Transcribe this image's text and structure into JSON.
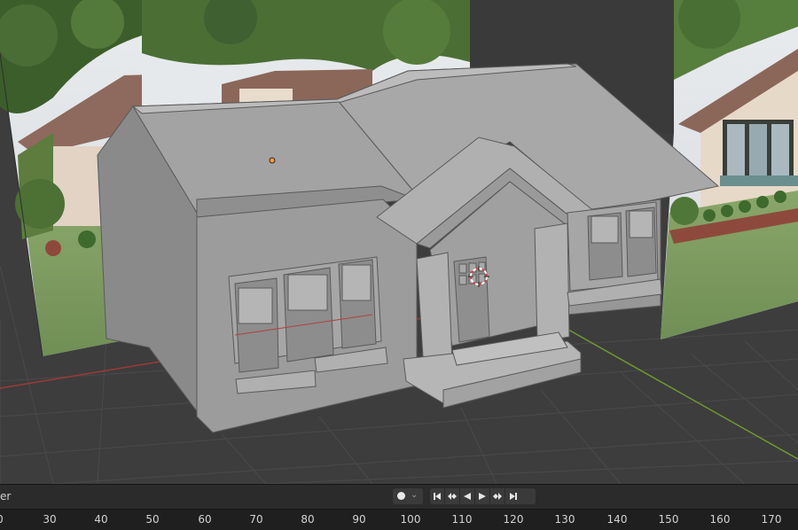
{
  "viewport": {
    "reference_image": "house-photo-reference",
    "model": "house-3d-model",
    "cursor_icon": "3d-cursor-icon",
    "origin_icon": "object-origin-icon"
  },
  "timeline_header": {
    "label_fragment": "er",
    "record_icon": "record-icon",
    "record_dropdown_icon": "chevron-down-icon",
    "transport_icons": [
      "jump-to-start-icon",
      "previous-keyframe-icon",
      "play-reverse-icon",
      "play-icon",
      "next-keyframe-icon",
      "jump-to-end-icon"
    ]
  },
  "timeline_ruler": {
    "ticks": [
      "0",
      "30",
      "40",
      "50",
      "60",
      "70",
      "80",
      "90",
      "100",
      "110",
      "120",
      "130",
      "140",
      "150",
      "160",
      "170"
    ]
  },
  "colors": {
    "viewport_bg": "#3d3d3d",
    "grid_line": "#4a4a4a",
    "x_axis": "#9b3a3a",
    "y_axis": "#6f9a2e",
    "model_gray": "#9a9a9a",
    "timeline_bg": "#2b2b2b"
  }
}
